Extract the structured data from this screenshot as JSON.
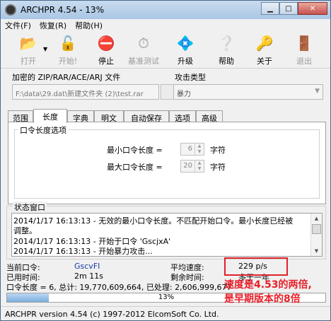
{
  "window": {
    "title": "ARCHPR 4.54 - 13%"
  },
  "menu": [
    "文件(F)",
    "恢复(R)",
    "帮助(H)"
  ],
  "toolbar": [
    {
      "label": "打开",
      "icon": "open-folder-icon",
      "enabled": false
    },
    {
      "label": "开始!",
      "icon": "start-icon",
      "enabled": false
    },
    {
      "label": "停止",
      "icon": "stop-icon",
      "enabled": true
    },
    {
      "label": "基准测试",
      "icon": "stopwatch-icon",
      "enabled": false
    },
    {
      "label": "升级",
      "icon": "upgrade-icon",
      "enabled": true
    },
    {
      "label": "帮助",
      "icon": "help-icon",
      "enabled": true
    },
    {
      "label": "关于",
      "icon": "about-icon",
      "enabled": true
    },
    {
      "label": "退出",
      "icon": "exit-door-icon",
      "enabled": false
    }
  ],
  "encrypted_file": {
    "label": "加密的 ZIP/RAR/ACE/ARJ 文件",
    "value": "F:\\data\\29.dat\\新建文件夹 (2)\\test.rar"
  },
  "attack_type": {
    "label": "攻击类型",
    "value": "暴力"
  },
  "tabs": [
    "范围",
    "长度",
    "字典",
    "明文",
    "自动保存",
    "选项",
    "高级"
  ],
  "active_tab": "长度",
  "length_options": {
    "group_title": "口令长度选项",
    "min_label": "最小口令长度 =",
    "min_value": "6",
    "max_label": "最大口令长度 =",
    "max_value": "20",
    "unit": "字符"
  },
  "status_window": {
    "title": "状态窗口",
    "lines": [
      "2014/1/17 16:13:13 - 无效的最小口令长度。不匹配开始口令。最小长度已经被",
      "调整。",
      "2014/1/17 16:13:13 - 开始于口令 'GscjxA'",
      "2014/1/17 16:13:13 - 开始暴力攻击..."
    ]
  },
  "stats": {
    "current_label": "当前口令:",
    "current_value": "GscvFI",
    "elapsed_label": "已用时间:",
    "elapsed_value": "2m 11s",
    "length_line": "口令长度 = 6, 总计: 19,770,609,664, 已处理: 2,606,999,677",
    "speed_label": "平均速度:",
    "speed_value": "229 p/s",
    "remaining_label": "剩余时间:",
    "remaining_value": "多于一年"
  },
  "progress": {
    "percent": 13,
    "text": "13%"
  },
  "statusbar": "ARCHPR version 4.54 (c) 1997-2012 ElcomSoft Co. Ltd.",
  "annotation": {
    "line1": "速度是4.53的两倍,",
    "line2": "是早期版本的8倍",
    "color": "#e8202a"
  }
}
